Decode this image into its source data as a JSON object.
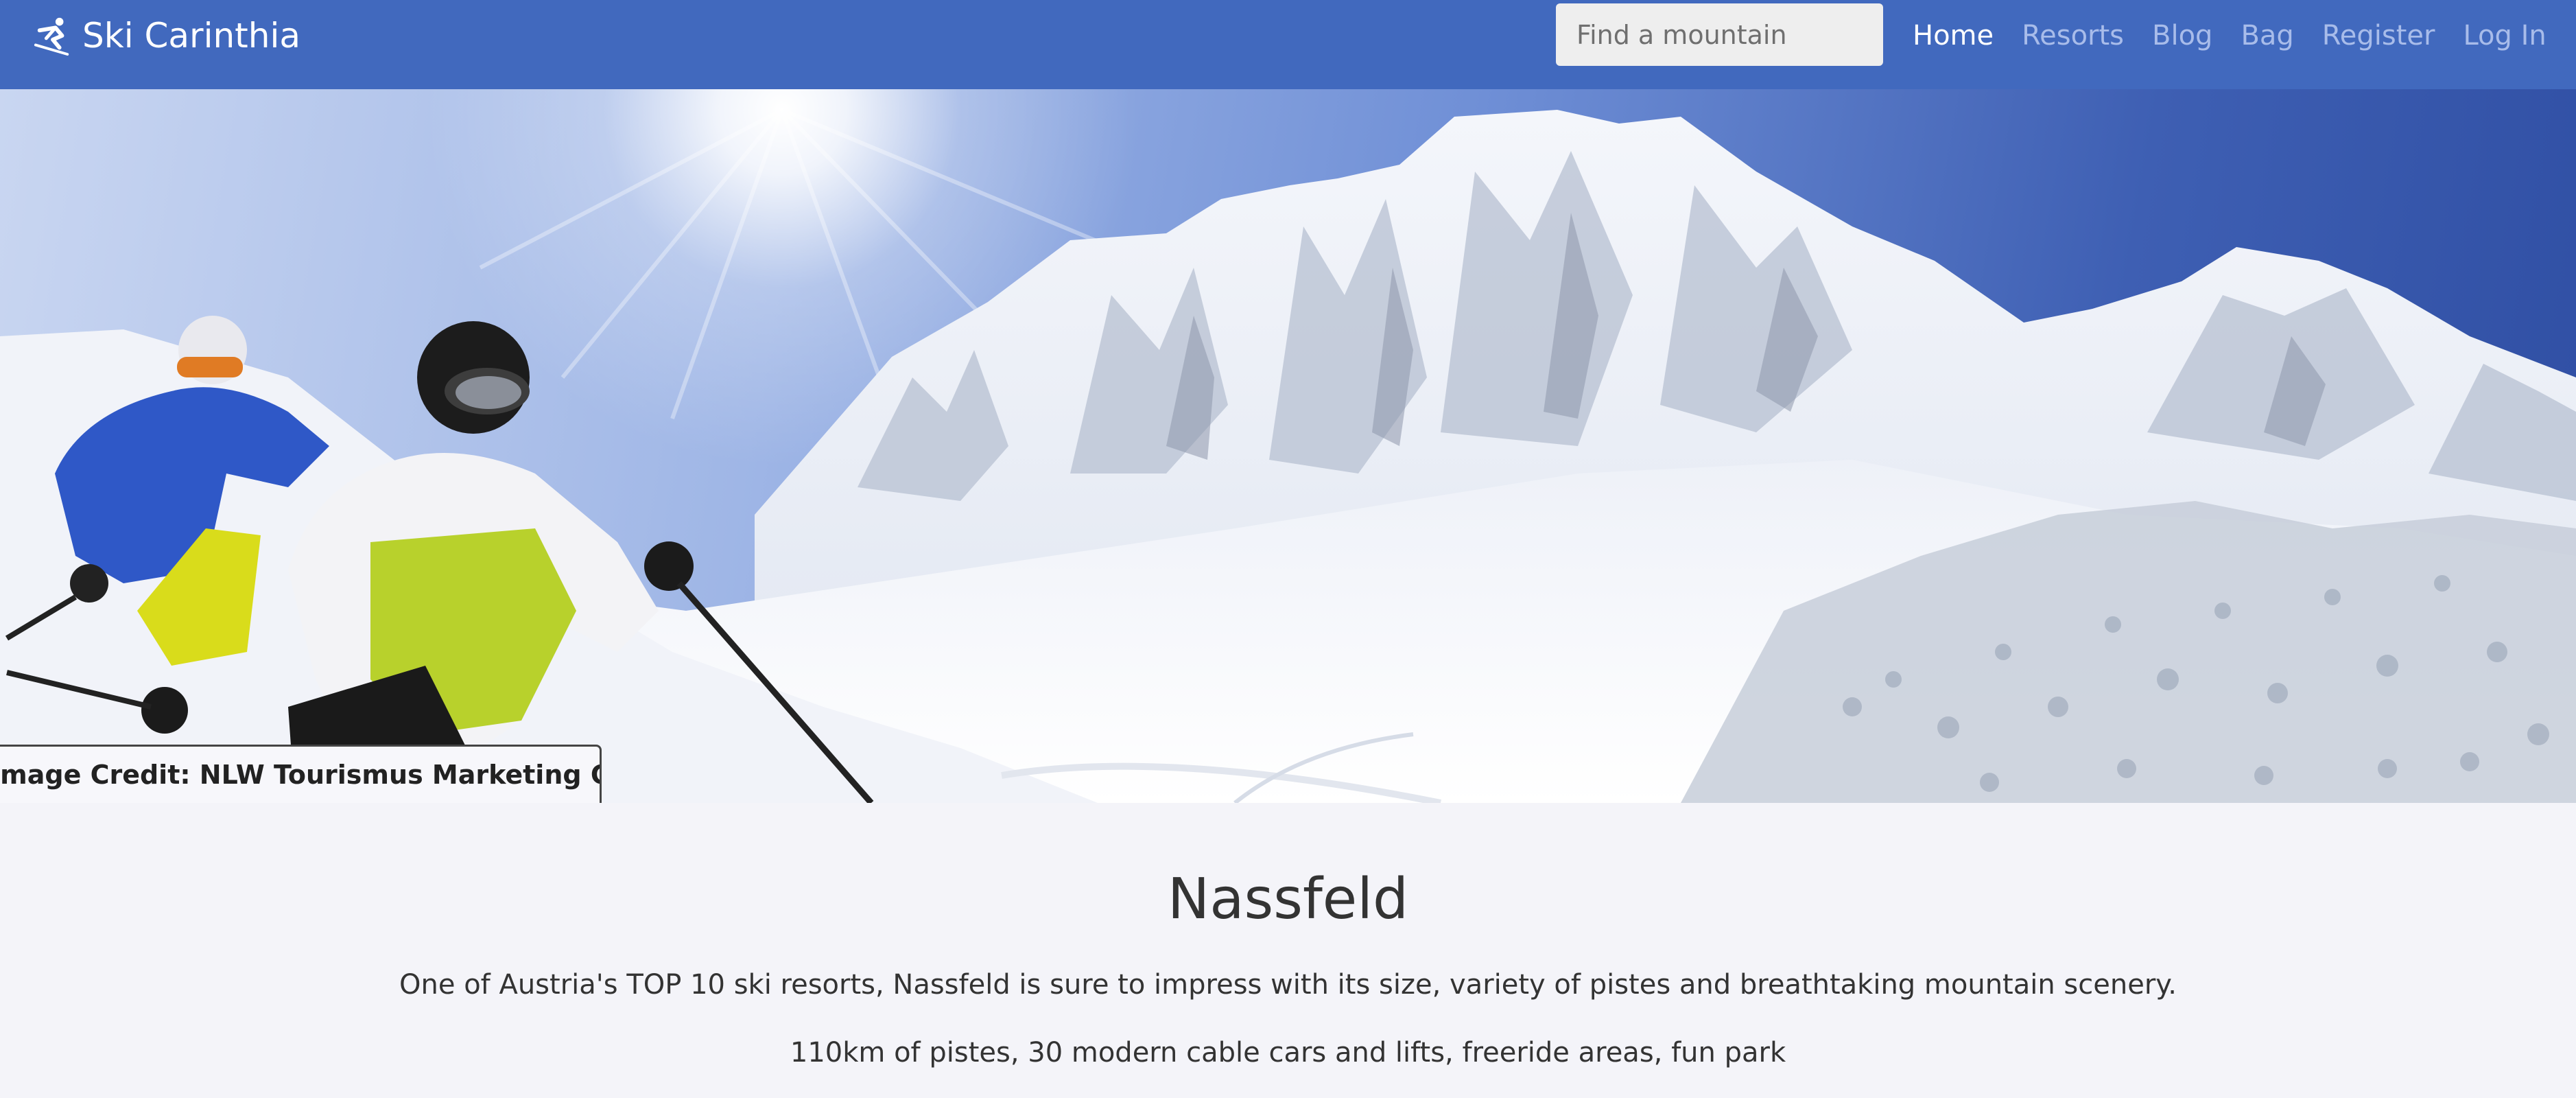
{
  "navbar": {
    "brand": "Ski Carinthia",
    "brand_icon": "skier-icon",
    "search_placeholder": "Find a mountain",
    "links": [
      {
        "label": "Home",
        "active": true
      },
      {
        "label": "Resorts",
        "active": false
      },
      {
        "label": "Blog",
        "active": false
      },
      {
        "label": "Bag",
        "active": false
      },
      {
        "label": "Register",
        "active": false
      },
      {
        "label": "Log In",
        "active": false
      }
    ]
  },
  "hero": {
    "image_credit": "Image Credit: NLW Tourismus Marketing GmbH"
  },
  "resort": {
    "name": "Nassfeld",
    "description": "One of Austria's TOP 10 ski resorts, Nassfeld is sure to impress with its size, variety of pistes and breathtaking mountain scenery.",
    "features": "110km of pistes, 30 modern cable cars and lifts, freeride areas, fun park"
  },
  "colors": {
    "navbar_bg": "#4169be",
    "nav_link": "#a8bcea",
    "nav_link_active": "#ffffff",
    "page_bg": "#f4f4f9",
    "text": "#333333"
  }
}
